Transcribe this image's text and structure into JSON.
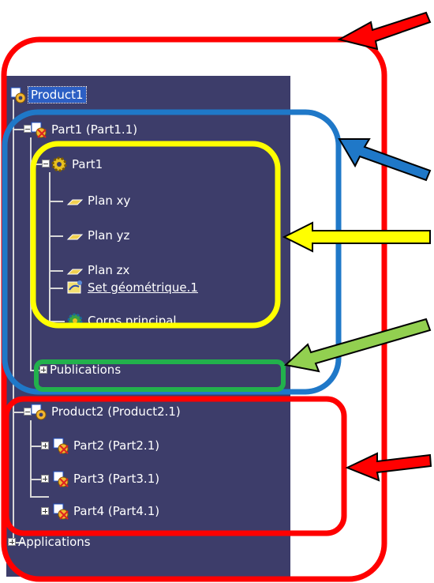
{
  "tree": {
    "root": "Product1",
    "part1_instance": "Part1 (Part1.1)",
    "part1": "Part1",
    "plan_xy": "Plan xy",
    "plan_yz": "Plan yz",
    "plan_zx": "Plan zx",
    "set_geometrique": "Set géométrique.1",
    "corps_principal": "Corps principal",
    "publications": "Publications",
    "product2": "Product2 (Product2.1)",
    "part2": "Part2 (Part2.1)",
    "part3": "Part3 (Part3.1)",
    "part4": "Part4 (Part4.1)",
    "applications": "Applications"
  },
  "colors": {
    "panel_bg": "#3d3d6a",
    "selection": "#2c5fc4",
    "red_annotation": "#ff0000",
    "blue_annotation": "#1f78c8",
    "yellow_annotation": "#ffff00",
    "green_annotation": "#22b14c",
    "green_arrow": "#92d050"
  }
}
